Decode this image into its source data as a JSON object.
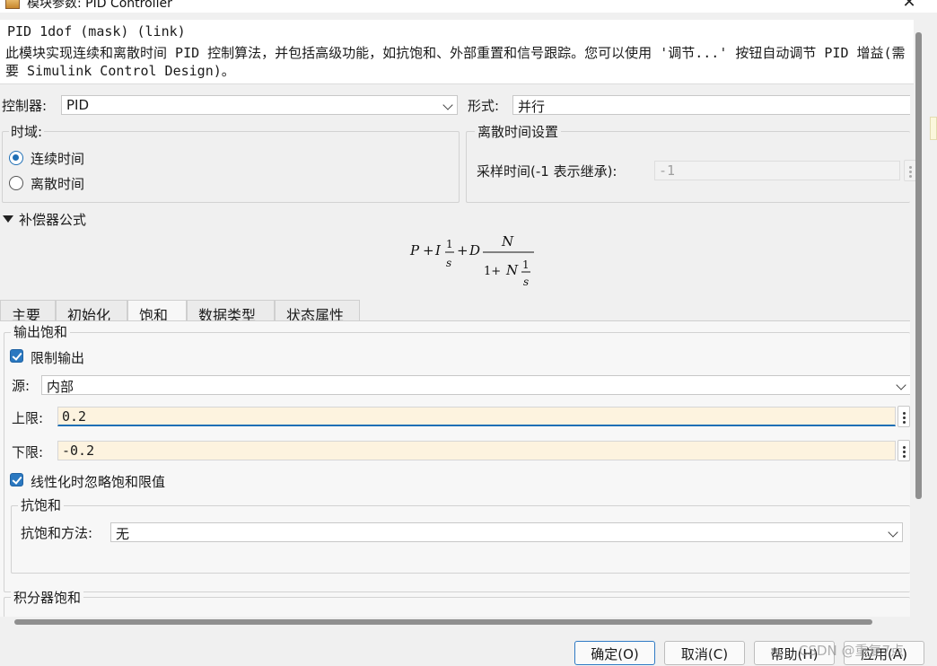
{
  "window": {
    "title": "模块参数: PID Controller",
    "close_glyph": "✕"
  },
  "description": {
    "header": "PID 1dof (mask) (link)",
    "text": "此模块实现连续和离散时间 PID 控制算法，并包括高级功能，如抗饱和、外部重置和信号跟踪。您可以使用 '调节...' 按钮自动调节 PID 增益(需要 Simulink Control Design)。"
  },
  "controller": {
    "label": "控制器:",
    "value": "PID",
    "form_label": "形式:",
    "form_value": "并行"
  },
  "time_domain": {
    "legend": "时域:",
    "options": [
      "连续时间",
      "离散时间"
    ],
    "selected": "连续时间"
  },
  "discrete_settings": {
    "legend": "离散时间设置",
    "sample_time_label": "采样时间(-1 表示继承):",
    "sample_time_value": "-1"
  },
  "compensator": {
    "label": "补偿器公式",
    "formula": {
      "p": "P",
      "plus": "+",
      "i": "I",
      "one": "1",
      "s": "s",
      "d": "D",
      "n": "N",
      "den_prefix": "1+"
    }
  },
  "tabs": [
    {
      "label": "主要"
    },
    {
      "label": "初始化"
    },
    {
      "label": "饱和"
    },
    {
      "label": "数据类型"
    },
    {
      "label": "状态属性"
    }
  ],
  "active_tab": "饱和",
  "output_saturation": {
    "legend": "输出饱和",
    "limit_output_label": "限制输出",
    "limit_output_checked": true,
    "source_label": "源:",
    "source_value": "内部",
    "upper_label": "上限:",
    "upper_value": "0.2",
    "lower_label": "下限:",
    "lower_value": "-0.2",
    "ignore_label": "线性化时忽略饱和限值",
    "ignore_checked": true
  },
  "anti_windup": {
    "legend": "抗饱和",
    "method_label": "抗饱和方法:",
    "method_value": "无"
  },
  "integrator_saturation": {
    "legend": "积分器饱和"
  },
  "buttons": {
    "ok": "确定(O)",
    "cancel": "取消(C)",
    "help": "帮助(H)",
    "apply": "应用(A)"
  },
  "watermark": "CSDN @重复7点",
  "colors": {
    "accent": "#1f6fb5",
    "field_highlight": "#fdf3df"
  }
}
